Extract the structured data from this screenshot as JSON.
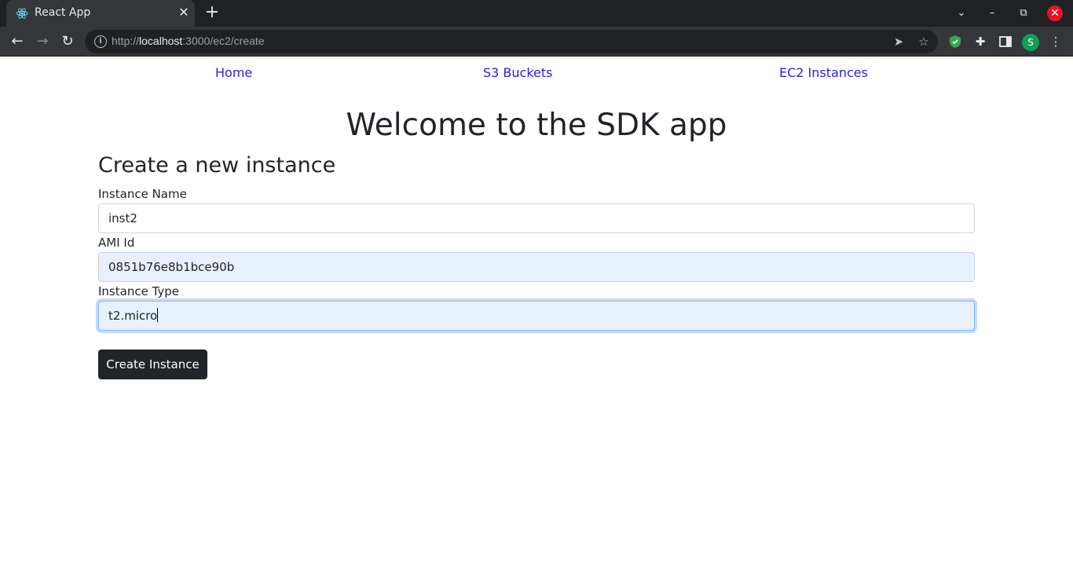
{
  "browser": {
    "tab_title": "React App",
    "tab_close": "✕",
    "new_tab": "+",
    "url_scheme": "http://",
    "url_host": "localhost",
    "url_path": ":3000/ec2/create",
    "avatar_letter": "S"
  },
  "nav": {
    "home": "Home",
    "s3": "S3 Buckets",
    "ec2": "EC2 Instances"
  },
  "heading": "Welcome to the SDK app",
  "form": {
    "title": "Create a new instance",
    "instance_name_label": "Instance Name",
    "instance_name_value": "inst2",
    "ami_label": "AMI Id",
    "ami_value": "0851b76e8b1bce90b",
    "type_label": "Instance Type",
    "type_value": "t2.micro",
    "submit_label": "Create Instance"
  },
  "colors": {
    "link": "#2a21d6",
    "button": "#212529",
    "autofill": "#e8f0fe",
    "chrome_dark": "#202124",
    "chrome_toolbar": "#35363a"
  },
  "icons": [
    "react-favicon-icon",
    "close-icon",
    "plus-icon",
    "chevron-down-icon",
    "minimize-icon",
    "restore-icon",
    "window-close-icon",
    "back-icon",
    "forward-icon",
    "reload-icon",
    "info-icon",
    "send-icon",
    "star-icon",
    "shield-extension-icon",
    "puzzle-icon",
    "sidepanel-icon",
    "kebab-menu-icon"
  ]
}
